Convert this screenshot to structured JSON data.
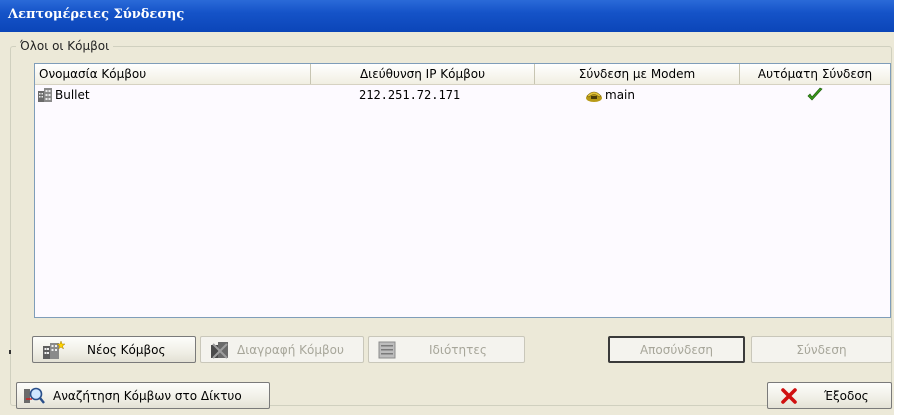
{
  "window": {
    "title": "Λεπτομέρειες Σύνδεσης"
  },
  "group": {
    "label": "Όλοι οι Κόμβοι"
  },
  "table": {
    "columns": [
      "Ονομασία Κόμβου",
      "Διεύθυνση IP Κόμβου",
      "Σύνδεση με Modem",
      "Αυτόματη Σύνδεση"
    ],
    "rows": [
      {
        "name": "Bullet",
        "ip": "212.251.72.171",
        "modem": "main",
        "auto": true
      }
    ]
  },
  "buttons": {
    "new_node": "Νέος Κόμβος",
    "delete_node": "Διαγραφή Κόμβου",
    "properties": "Ιδιότητες",
    "disconnect": "Αποσύνδεση",
    "connect": "Σύνδεση",
    "search_network": "Αναζήτηση Κόμβων στο Δίκτυο",
    "exit": "Έξοδος"
  },
  "icons": {
    "row_node": "building-icon",
    "modem": "phone-modem-icon",
    "auto_connect": "check-icon",
    "exit": "red-x-icon"
  },
  "colors": {
    "title_bar": "#1553c8",
    "panel": "#ece9d8",
    "list_background": "#fdfaff",
    "check": "#3a9a1a",
    "exit_x": "#d01010"
  }
}
